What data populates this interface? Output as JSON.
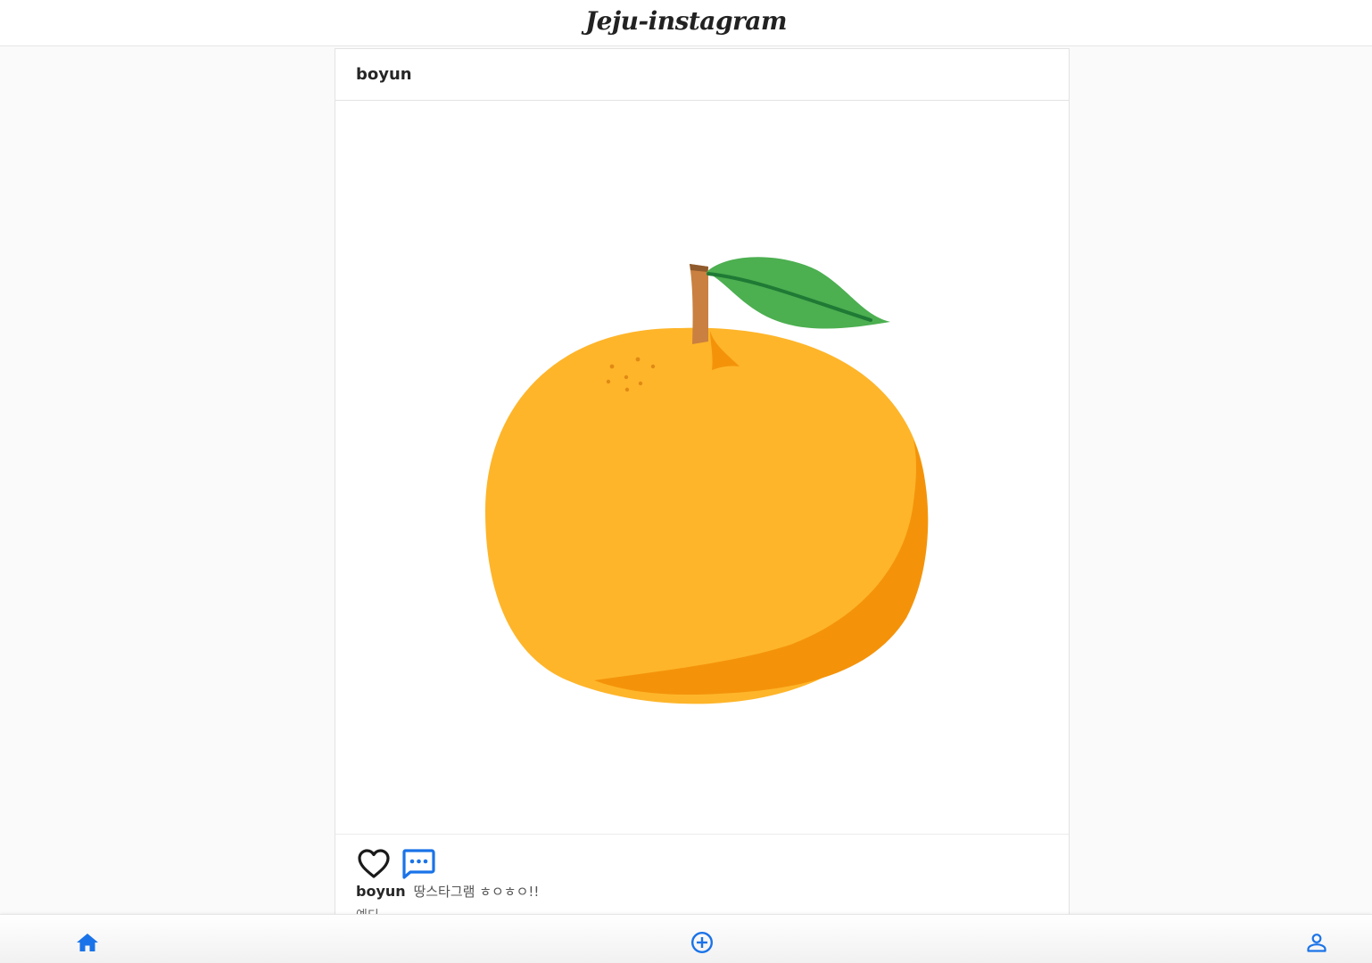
{
  "app": {
    "title": "Jeju-instagram"
  },
  "post": {
    "username": "boyun",
    "image_alt": "tangerine illustration",
    "caption_user": "boyun",
    "caption_text": "땅스타그램 ㅎㅇㅎㅇ!!",
    "comment_preview": "예디~"
  },
  "nav": {
    "items": [
      {
        "name": "home",
        "icon": "home-icon"
      },
      {
        "name": "add",
        "icon": "add-circle-icon"
      },
      {
        "name": "profile",
        "icon": "person-icon"
      }
    ]
  },
  "colors": {
    "accent": "#1a73e8",
    "orange": "#feb52a",
    "orange_shade": "#f4930a",
    "leaf": "#4caf50",
    "stem": "#c98040"
  }
}
